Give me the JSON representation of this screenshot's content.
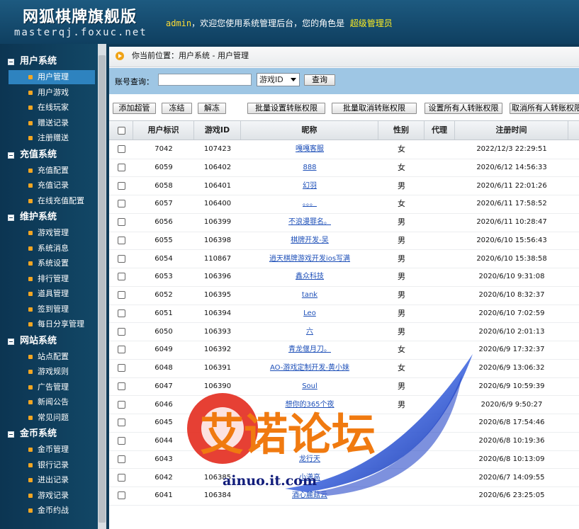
{
  "header": {
    "logo_cn": "网狐棋牌旗舰版",
    "logo_en": "masterqj.foxuc.net",
    "welcome_user": "admin",
    "welcome_mid": "，欢迎您使用系统管理后台，您的角色是",
    "welcome_role": "超级管理员"
  },
  "sidebar": {
    "groups": [
      {
        "title": "用户系统",
        "items": [
          "用户管理",
          "用户游戏",
          "在线玩家",
          "赠送记录",
          "注册赠送"
        ]
      },
      {
        "title": "充值系统",
        "items": [
          "充值配置",
          "充值记录",
          "在线充值配置"
        ]
      },
      {
        "title": "维护系统",
        "items": [
          "游戏管理",
          "系统消息",
          "系统设置",
          "排行管理",
          "道具管理",
          "签到管理",
          "每日分享管理"
        ]
      },
      {
        "title": "网站系统",
        "items": [
          "站点配置",
          "游戏规则",
          "广告管理",
          "新闻公告",
          "常见问题"
        ]
      },
      {
        "title": "金币系统",
        "items": [
          "金币管理",
          "银行记录",
          "进出记录",
          "游戏记录",
          "金币约战"
        ]
      }
    ]
  },
  "main": {
    "breadcrumb": "你当前位置：用户系统 - 用户管理",
    "search": {
      "label": "账号查询：",
      "value": "",
      "select_value": "游戏ID",
      "button": "查询"
    },
    "toolbar": [
      "添加超管",
      "冻结",
      "解冻",
      "批量设置转账权限",
      "批量取消转账权限",
      "设置所有人转账权限",
      "取消所有人转账权限"
    ],
    "columns": [
      "用户标识",
      "游戏ID",
      "昵称",
      "性别",
      "代理",
      "注册时间"
    ],
    "rows": [
      {
        "uid": "7042",
        "gid": "107423",
        "nick": "嘎嘎客服",
        "sex": "女",
        "agent": "",
        "time": "2022/12/3 22:29:51"
      },
      {
        "uid": "6059",
        "gid": "106402",
        "nick": "888",
        "sex": "女",
        "agent": "",
        "time": "2020/6/12 14:56:33"
      },
      {
        "uid": "6058",
        "gid": "106401",
        "nick": "幻羽",
        "sex": "男",
        "agent": "",
        "time": "2020/6/11 22:01:26"
      },
      {
        "uid": "6057",
        "gid": "106400",
        "nick": "。。。",
        "sex": "女",
        "agent": "",
        "time": "2020/6/11 17:58:52"
      },
      {
        "uid": "6056",
        "gid": "106399",
        "nick": "不浪漫罪名。",
        "sex": "男",
        "agent": "",
        "time": "2020/6/11 10:28:47"
      },
      {
        "uid": "6055",
        "gid": "106398",
        "nick": "棋牌开发-吴",
        "sex": "男",
        "agent": "",
        "time": "2020/6/10 15:56:43"
      },
      {
        "uid": "6054",
        "gid": "110867",
        "nick": "逍天棋牌游戏开发ios写满",
        "sex": "男",
        "agent": "",
        "time": "2020/6/10 15:38:58"
      },
      {
        "uid": "6053",
        "gid": "106396",
        "nick": "鑫众科技",
        "sex": "男",
        "agent": "",
        "time": "2020/6/10 9:31:08"
      },
      {
        "uid": "6052",
        "gid": "106395",
        "nick": "tank",
        "sex": "男",
        "agent": "",
        "time": "2020/6/10 8:32:37"
      },
      {
        "uid": "6051",
        "gid": "106394",
        "nick": "Leo",
        "sex": "男",
        "agent": "",
        "time": "2020/6/10 7:02:59"
      },
      {
        "uid": "6050",
        "gid": "106393",
        "nick": "六",
        "sex": "男",
        "agent": "",
        "time": "2020/6/10 2:01:13"
      },
      {
        "uid": "6049",
        "gid": "106392",
        "nick": "青龙偃月刀。",
        "sex": "女",
        "agent": "",
        "time": "2020/6/9 17:32:37"
      },
      {
        "uid": "6048",
        "gid": "106391",
        "nick": "AO-游戏定制开发-黄小妹",
        "sex": "女",
        "agent": "",
        "time": "2020/6/9 13:06:32"
      },
      {
        "uid": "6047",
        "gid": "106390",
        "nick": "Soul",
        "sex": "男",
        "agent": "",
        "time": "2020/6/9 10:59:39"
      },
      {
        "uid": "6046",
        "gid": "",
        "nick": "想你的365个夜",
        "sex": "男",
        "agent": "",
        "time": "2020/6/9 9:50:27"
      },
      {
        "uid": "6045",
        "gid": "",
        "nick": "",
        "sex": "",
        "agent": "",
        "time": "2020/6/8 17:54:46"
      },
      {
        "uid": "6044",
        "gid": "",
        "nick": "",
        "sex": "",
        "agent": "",
        "time": "2020/6/8 10:19:36"
      },
      {
        "uid": "6043",
        "gid": "",
        "nick": "龙行天",
        "sex": "",
        "agent": "",
        "time": "2020/6/8 10:13:09"
      },
      {
        "uid": "6042",
        "gid": "106385",
        "nick": "小潇高",
        "sex": "",
        "agent": "",
        "time": "2020/6/7 14:09:55"
      },
      {
        "uid": "6041",
        "gid": "106384",
        "nick": "酒心麓菇云",
        "sex": "",
        "agent": "",
        "time": "2020/6/6 23:25:05"
      }
    ]
  },
  "watermark": {
    "title": "艾诺论坛",
    "url": "ainuo.it.com"
  }
}
